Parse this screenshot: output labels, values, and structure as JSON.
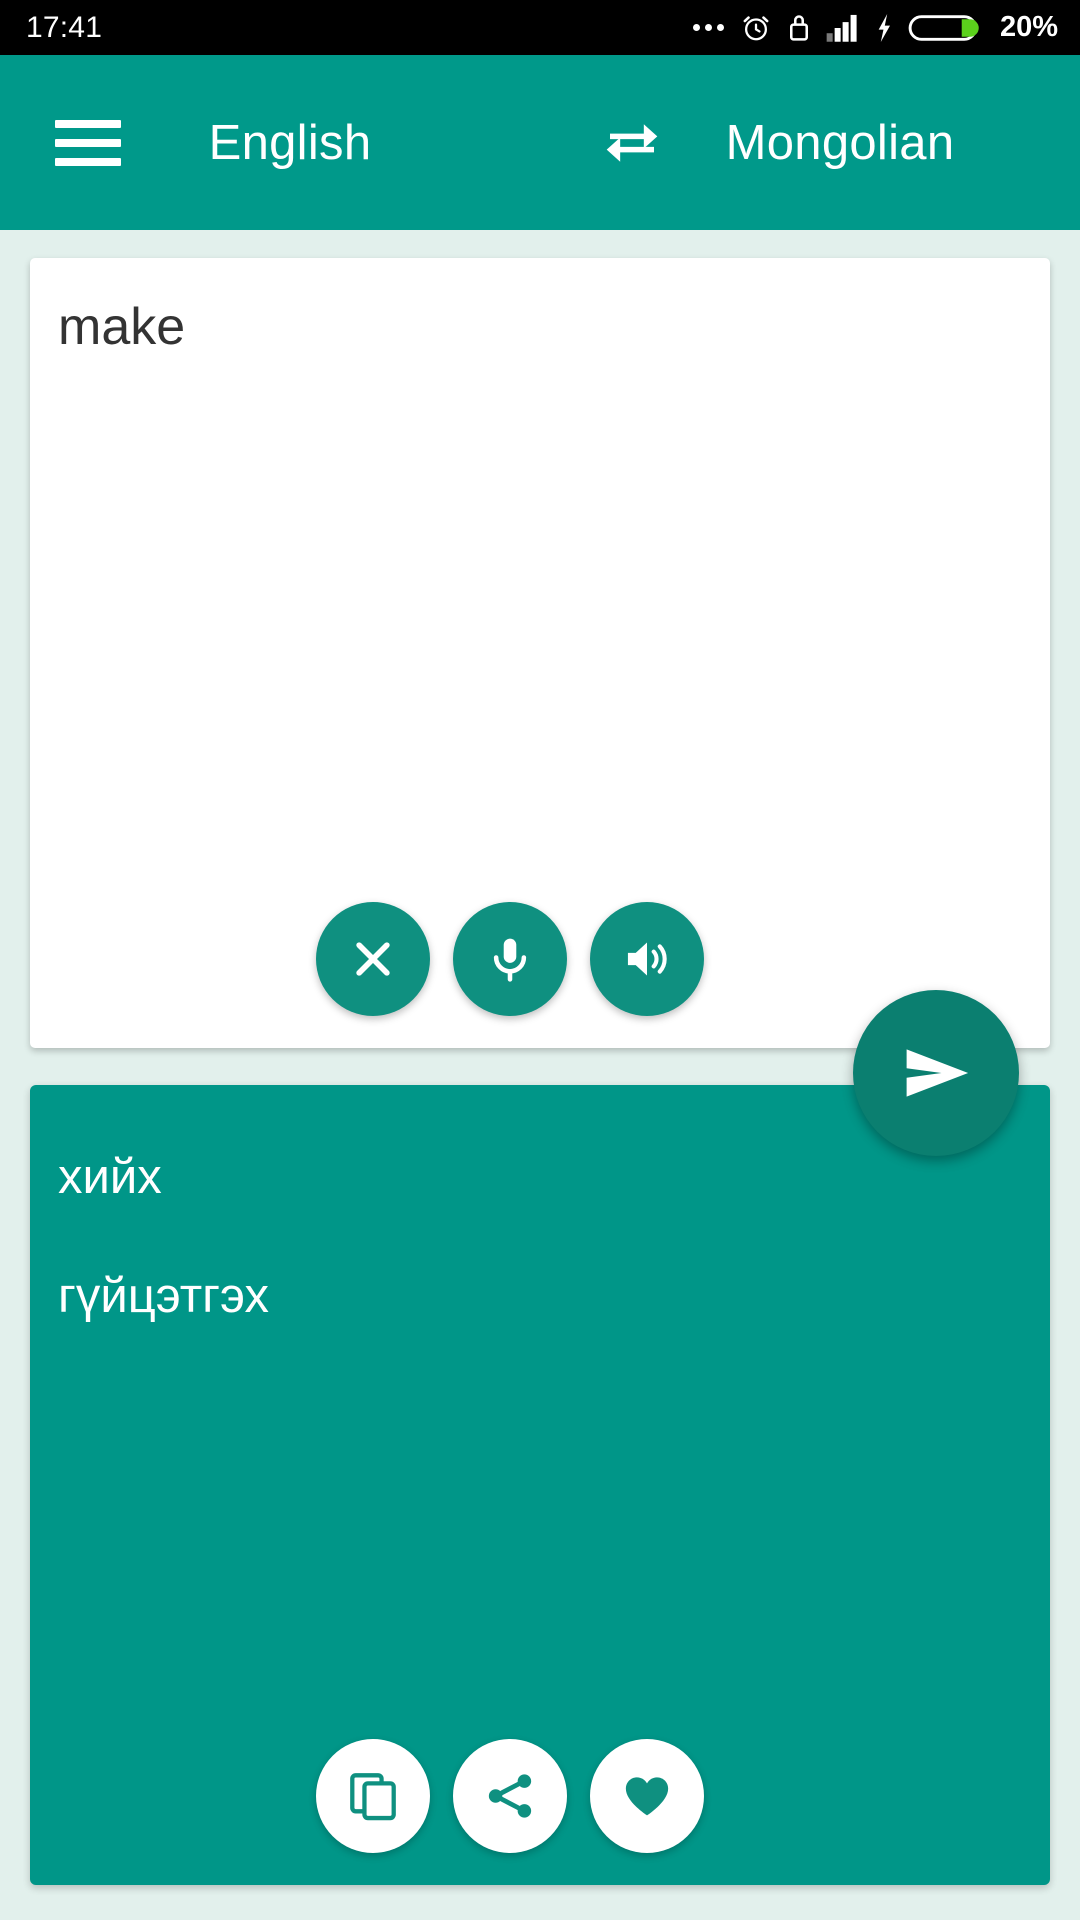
{
  "status_bar": {
    "time": "17:41",
    "battery_percent": "20%",
    "icons": [
      "more-dots-icon",
      "alarm-clock-icon",
      "usb-lock-icon",
      "signal-bars-icon",
      "charging-bolt-icon",
      "battery-icon"
    ]
  },
  "app_bar": {
    "menu_icon": "hamburger-menu-icon",
    "source_language": "English",
    "swap_icon": "swap-languages-icon",
    "target_language": "Mongolian"
  },
  "input": {
    "text": "make",
    "placeholder": "",
    "actions": [
      {
        "name": "clear-button",
        "icon": "close-icon"
      },
      {
        "name": "microphone-button",
        "icon": "microphone-icon"
      },
      {
        "name": "speak-button",
        "icon": "speaker-icon"
      }
    ]
  },
  "send": {
    "label": "Send",
    "icon": "send-icon"
  },
  "output": {
    "translations": [
      "хийх",
      "гүйцэтгэх"
    ],
    "actions": [
      {
        "name": "copy-button",
        "icon": "copy-icon"
      },
      {
        "name": "share-button",
        "icon": "share-icon"
      },
      {
        "name": "favorite-button",
        "icon": "heart-icon"
      }
    ]
  },
  "colors": {
    "primary": "#00998A",
    "card_teal": "#009688",
    "button_teal": "#0F9080",
    "fab_teal": "#0B7F70",
    "background": "#E2F0EC",
    "battery_green": "#5BD11C",
    "status_bar": "#000000",
    "input_text": "#333333"
  }
}
